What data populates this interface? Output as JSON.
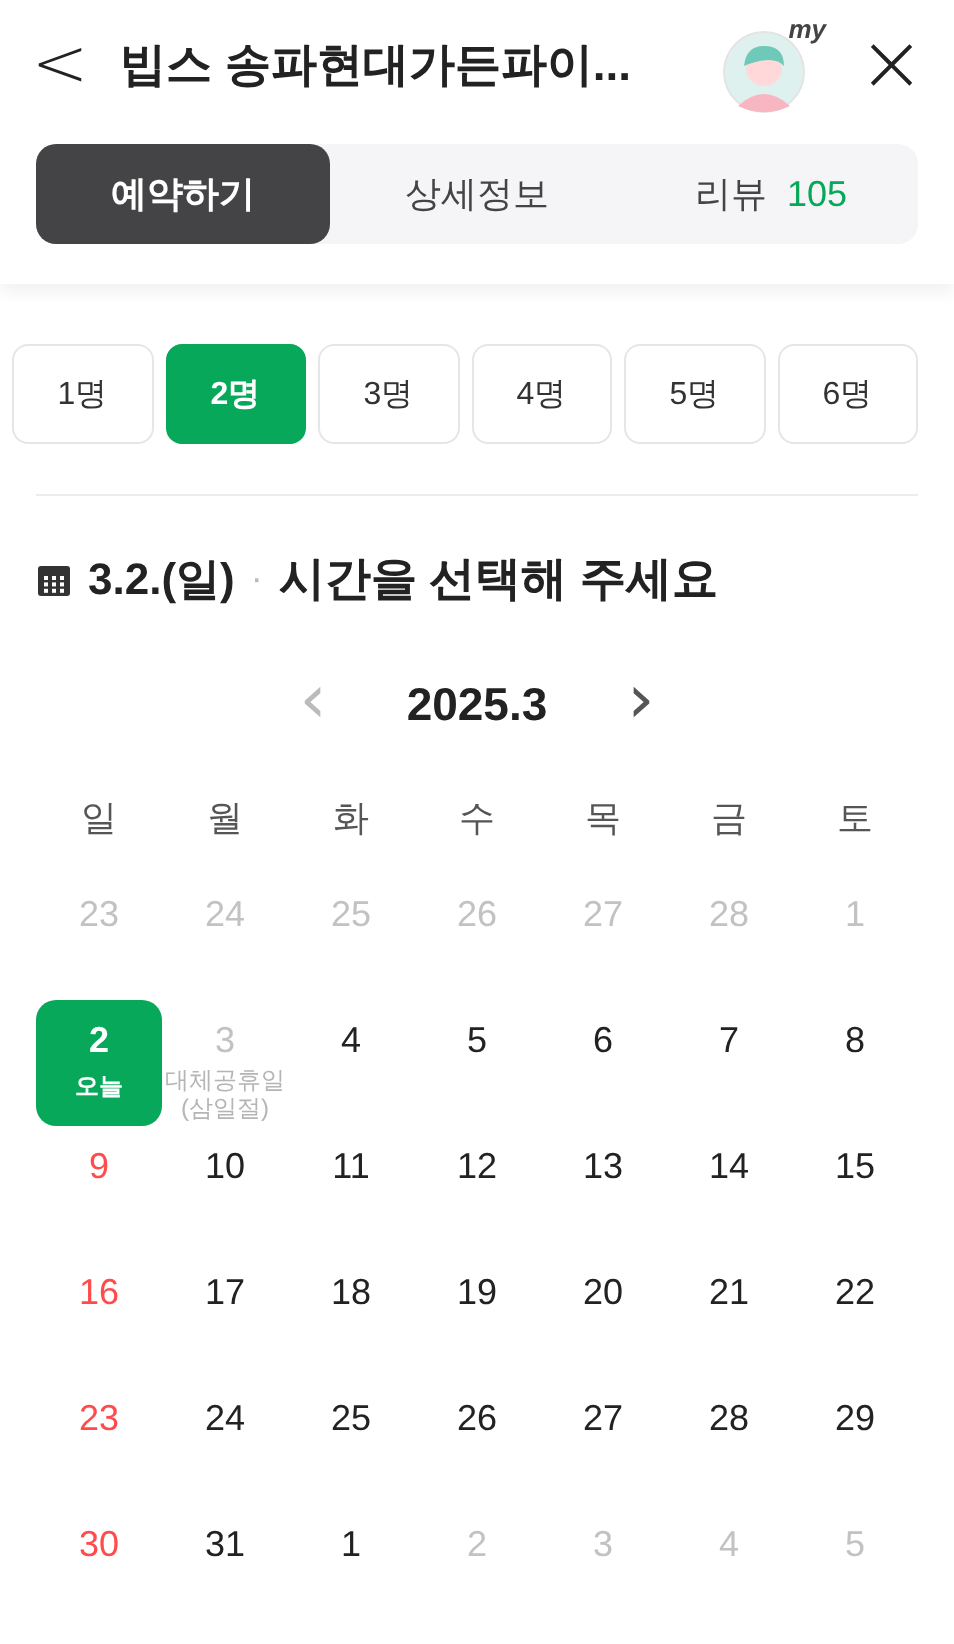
{
  "header": {
    "back": "<",
    "title": "빕스 송파현대가든파이...",
    "avatar_badge": "my",
    "close": "×"
  },
  "tabs": [
    {
      "label": "예약하기",
      "selected": true
    },
    {
      "label": "상세정보",
      "selected": false
    },
    {
      "label": "리뷰",
      "count": "105",
      "selected": false
    }
  ],
  "party_sizes": [
    {
      "label": "1명",
      "selected": false
    },
    {
      "label": "2명",
      "selected": true
    },
    {
      "label": "3명",
      "selected": false
    },
    {
      "label": "4명",
      "selected": false
    },
    {
      "label": "5명",
      "selected": false
    },
    {
      "label": "6명",
      "selected": false
    }
  ],
  "section": {
    "date": "3.2.(일)",
    "separator": "·",
    "title": "시간을 선택해 주세요"
  },
  "calendar": {
    "month": "2025.3",
    "prev": "‹",
    "next": "›",
    "weekdays": [
      "일",
      "월",
      "화",
      "수",
      "목",
      "금",
      "토"
    ],
    "days": [
      {
        "label": "23",
        "kind": "disabled",
        "selected": false
      },
      {
        "label": "24",
        "kind": "disabled",
        "selected": false
      },
      {
        "label": "25",
        "kind": "disabled",
        "selected": false
      },
      {
        "label": "26",
        "kind": "disabled",
        "selected": false
      },
      {
        "label": "27",
        "kind": "disabled",
        "selected": false
      },
      {
        "label": "28",
        "kind": "disabled",
        "selected": false
      },
      {
        "label": "1",
        "kind": "disabled",
        "selected": false
      },
      {
        "label": "2",
        "kind": "sunday",
        "selected": true,
        "sub": "오늘"
      },
      {
        "label": "3",
        "kind": "disabled",
        "selected": false,
        "note": "대체공휴일 (삼일절)"
      },
      {
        "label": "4",
        "kind": "normal",
        "selected": false
      },
      {
        "label": "5",
        "kind": "normal",
        "selected": false
      },
      {
        "label": "6",
        "kind": "normal",
        "selected": false
      },
      {
        "label": "7",
        "kind": "normal",
        "selected": false
      },
      {
        "label": "8",
        "kind": "normal",
        "selected": false
      },
      {
        "label": "9",
        "kind": "sunday",
        "selected": false
      },
      {
        "label": "10",
        "kind": "normal",
        "selected": false
      },
      {
        "label": "11",
        "kind": "normal",
        "selected": false
      },
      {
        "label": "12",
        "kind": "normal",
        "selected": false
      },
      {
        "label": "13",
        "kind": "normal",
        "selected": false
      },
      {
        "label": "14",
        "kind": "normal",
        "selected": false
      },
      {
        "label": "15",
        "kind": "normal",
        "selected": false
      },
      {
        "label": "16",
        "kind": "sunday",
        "selected": false
      },
      {
        "label": "17",
        "kind": "normal",
        "selected": false
      },
      {
        "label": "18",
        "kind": "normal",
        "selected": false
      },
      {
        "label": "19",
        "kind": "normal",
        "selected": false
      },
      {
        "label": "20",
        "kind": "normal",
        "selected": false
      },
      {
        "label": "21",
        "kind": "normal",
        "selected": false
      },
      {
        "label": "22",
        "kind": "normal",
        "selected": false
      },
      {
        "label": "23",
        "kind": "sunday",
        "selected": false
      },
      {
        "label": "24",
        "kind": "normal",
        "selected": false
      },
      {
        "label": "25",
        "kind": "normal",
        "selected": false
      },
      {
        "label": "26",
        "kind": "normal",
        "selected": false
      },
      {
        "label": "27",
        "kind": "normal",
        "selected": false
      },
      {
        "label": "28",
        "kind": "normal",
        "selected": false
      },
      {
        "label": "29",
        "kind": "normal",
        "selected": false
      },
      {
        "label": "30",
        "kind": "sunday",
        "selected": false
      },
      {
        "label": "31",
        "kind": "normal",
        "selected": false
      },
      {
        "label": "1",
        "kind": "normal",
        "selected": false
      },
      {
        "label": "2",
        "kind": "disabled",
        "selected": false
      },
      {
        "label": "3",
        "kind": "disabled",
        "selected": false
      },
      {
        "label": "4",
        "kind": "disabled",
        "selected": false
      },
      {
        "label": "5",
        "kind": "disabled",
        "selected": false
      }
    ]
  }
}
